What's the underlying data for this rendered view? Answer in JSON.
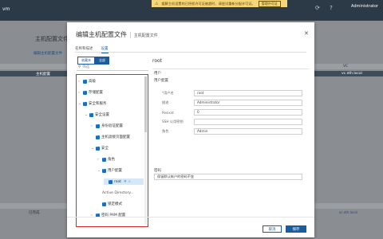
{
  "warning": {
    "text": "缓解主机设置的已授权许可证被超时，请尝试重新分配许可证。",
    "button": "管理许可证"
  },
  "header": {
    "logo": "vm",
    "user": "Administrator"
  },
  "background": {
    "page_title": "主机配置文件",
    "link": "编辑主机配置文件",
    "row_left": "主机配置",
    "row_right": "vc.eth.local",
    "col_vc": "VC",
    "status": "已完成",
    "bottom_right": "vc.eth.local"
  },
  "modal": {
    "title": "编辑主机配置文件",
    "subtitle": "主机配置文件",
    "tabs": [
      {
        "label": "名称和描述",
        "active": false
      },
      {
        "label": "设置",
        "active": true
      }
    ],
    "segments": [
      {
        "label": "收藏夹",
        "active": false
      },
      {
        "label": "全部",
        "active": true
      }
    ],
    "filter_placeholder": "筛选",
    "tree": [
      {
        "label": "高级",
        "level": 0,
        "chev": "›",
        "checked": true
      },
      {
        "label": "存储配置",
        "level": 0,
        "chev": "›",
        "checked": true
      },
      {
        "label": "安全和服务",
        "level": 0,
        "chev": "⌄",
        "checked": true
      },
      {
        "label": "安全设置",
        "level": 1,
        "chev": "⌄",
        "checked": true
      },
      {
        "label": "身份验证配置",
        "level": 2,
        "chev": "›",
        "checked": true
      },
      {
        "label": "主机滤接页面配置",
        "level": 2,
        "chev": "",
        "checked": true
      },
      {
        "label": "安全",
        "level": 2,
        "chev": "⌄",
        "checked": true
      },
      {
        "label": "角色",
        "level": 3,
        "chev": "›",
        "checked": true
      },
      {
        "label": "用户配置",
        "level": 3,
        "chev": "⌄",
        "checked": true
      },
      {
        "label": "root",
        "level": 4,
        "chev": "",
        "checked": true,
        "selected": true
      },
      {
        "label": "Active Directory...",
        "level": 3,
        "chev": "",
        "checked": false
      },
      {
        "label": "锁定模式",
        "level": 3,
        "chev": "",
        "checked": true
      },
      {
        "label": "密码 PAM 配置",
        "level": 2,
        "chev": "›",
        "checked": true
      }
    ],
    "right": {
      "heading": "root",
      "section_user": "用户",
      "section_user_config": "用户配置",
      "fields": [
        {
          "label": "*用户名",
          "value": "root"
        },
        {
          "label": "描述",
          "value": "Administrator"
        },
        {
          "label": "Posixid",
          "value": "0"
        },
        {
          "label": "SSH 公用密钥",
          "value": ""
        },
        {
          "label": "角色",
          "value": "Admin"
        }
      ],
      "section_password": "密码",
      "password_value": "保留默认帐户的密码不变"
    },
    "cancel": "取消",
    "save": "保存"
  },
  "colors": {
    "accent": "#1a5c9c",
    "highlight_border": "#d9262b",
    "warning_bg": "#f7d679"
  }
}
